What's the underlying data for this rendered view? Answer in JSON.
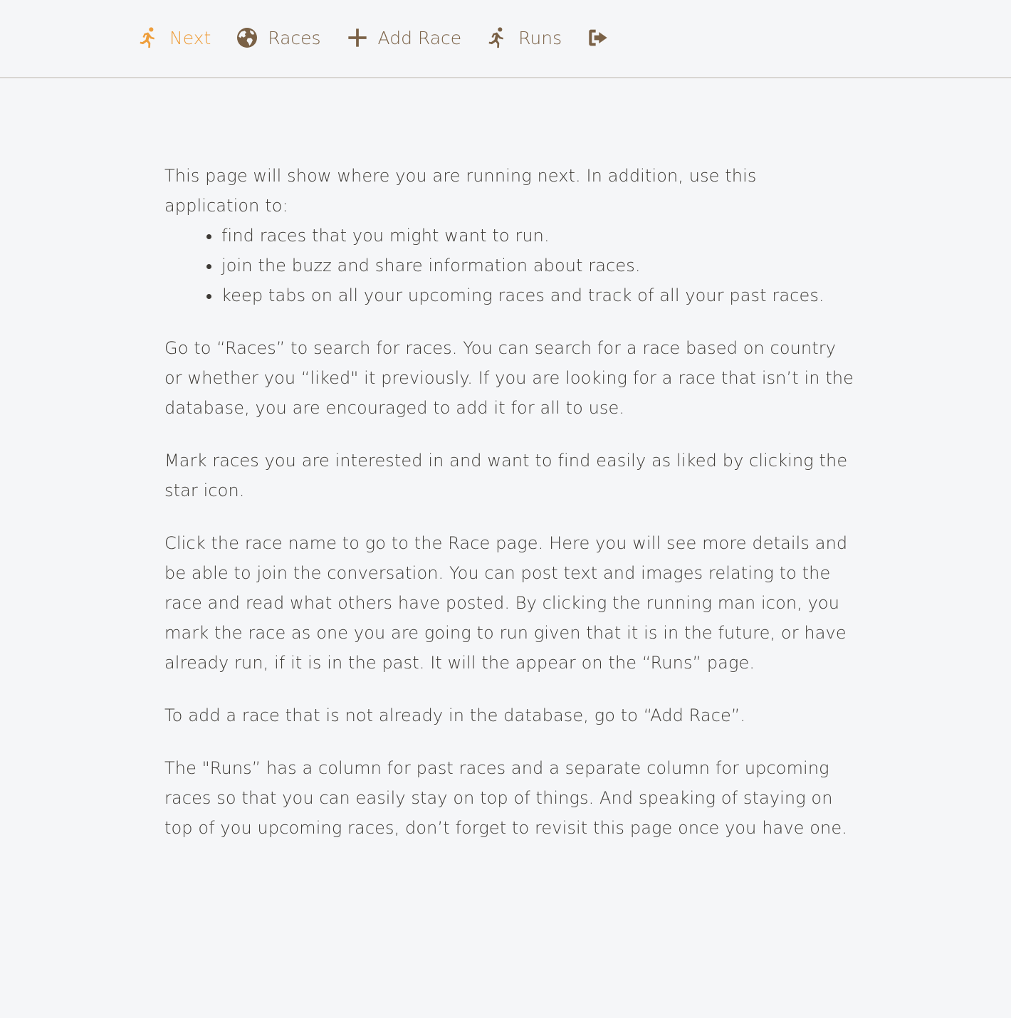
{
  "nav": {
    "items": [
      {
        "label": "Next",
        "icon": "running-man-icon",
        "active": true
      },
      {
        "label": "Races",
        "icon": "globe-icon",
        "active": false
      },
      {
        "label": "Add Race",
        "icon": "plus-icon",
        "active": false
      },
      {
        "label": "Runs",
        "icon": "running-man-icon",
        "active": false
      }
    ],
    "logout_icon": "sign-out-icon"
  },
  "colors": {
    "accent": "#ee9e3c",
    "nav_text": "#7a6146",
    "body_text": "#3d3a35",
    "background": "#f5f6f8"
  },
  "content": {
    "intro": "This page will show where you are running next. In addition, use this application to:",
    "bullets": [
      "find races that you might want to run.",
      "join the buzz and share information about races.",
      "keep tabs on all your upcoming races and track of all your past races."
    ],
    "paragraphs": [
      "Go to “Races” to search for races. You can search for a race based on country or whether you “liked\" it previously. If you are looking for a race that isn’t in the database, you are encouraged to add it for all to use.",
      "Mark races you are interested in and want to find easily as liked by clicking the star icon.",
      "Click the race name to go to the Race page. Here you will see more details and be able to join the conversation. You can post text and images relating to the race and read what others have posted. By clicking the running man icon, you mark the race as one you are going to run given that it is in the future, or have already run, if it is in the past. It will the appear on the “Runs” page.",
      "To add a race that is not already in the database, go to “Add Race”.",
      "The \"Runs” has a column for past races and a separate column for upcoming races so that you can easily stay on top of things. And speaking of staying on top of you upcoming races, don’t forget to revisit this page once you have one."
    ]
  }
}
